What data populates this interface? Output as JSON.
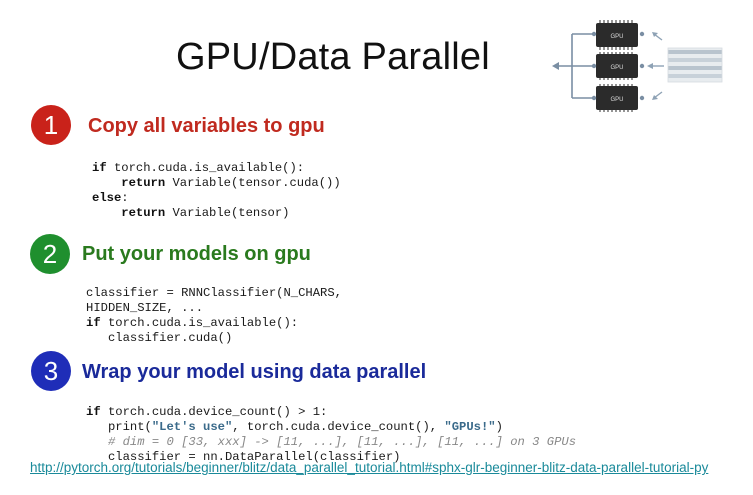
{
  "slide": {
    "title": "GPU/Data Parallel",
    "diagram": {
      "chip_label": "GPU",
      "chip_count": 3
    },
    "sections": [
      {
        "number": "1",
        "heading": "Copy all variables to gpu",
        "color": "#c9221a",
        "code": [
          {
            "kw": "if",
            "rest": " torch.cuda.is_available():"
          },
          {
            "indent": "    ",
            "kw": "return",
            "rest": " Variable(tensor.cuda())"
          },
          {
            "kw": "else",
            "rest": ":"
          },
          {
            "indent": "    ",
            "kw": "return",
            "rest": " Variable(tensor)"
          }
        ]
      },
      {
        "number": "2",
        "heading": "Put your models on gpu",
        "color": "#1f8f2e",
        "code": [
          {
            "rest": "classifier = RNNClassifier(N_CHARS,"
          },
          {
            "rest": "HIDDEN_SIZE, ..."
          },
          {
            "kw": "if",
            "rest": " torch.cuda.is_available():"
          },
          {
            "indent": "   ",
            "rest": "classifier.cuda()"
          }
        ]
      },
      {
        "number": "3",
        "heading": "Wrap your model using data parallel",
        "color": "#1f2db8",
        "code": [
          {
            "kw": "if",
            "rest": " torch.cuda.device_count() > 1:"
          },
          {
            "indent": "   ",
            "pre": "print(",
            "str1": "\"Let's use\"",
            "mid": ", torch.cuda.device_count(), ",
            "str2": "\"GPUs!\"",
            "post": ")"
          },
          {
            "indent": "   ",
            "comment": "# dim = 0 [33, xxx] -> [11, ...], [11, ...], [11, ...] on 3 GPUs"
          },
          {
            "indent": "   ",
            "rest": "classifier = nn.DataParallel(classifier)"
          }
        ]
      }
    ],
    "link": "http://pytorch.org/tutorials/beginner/blitz/data_parallel_tutorial.html#sphx-glr-beginner-blitz-data-parallel-tutorial-py"
  }
}
